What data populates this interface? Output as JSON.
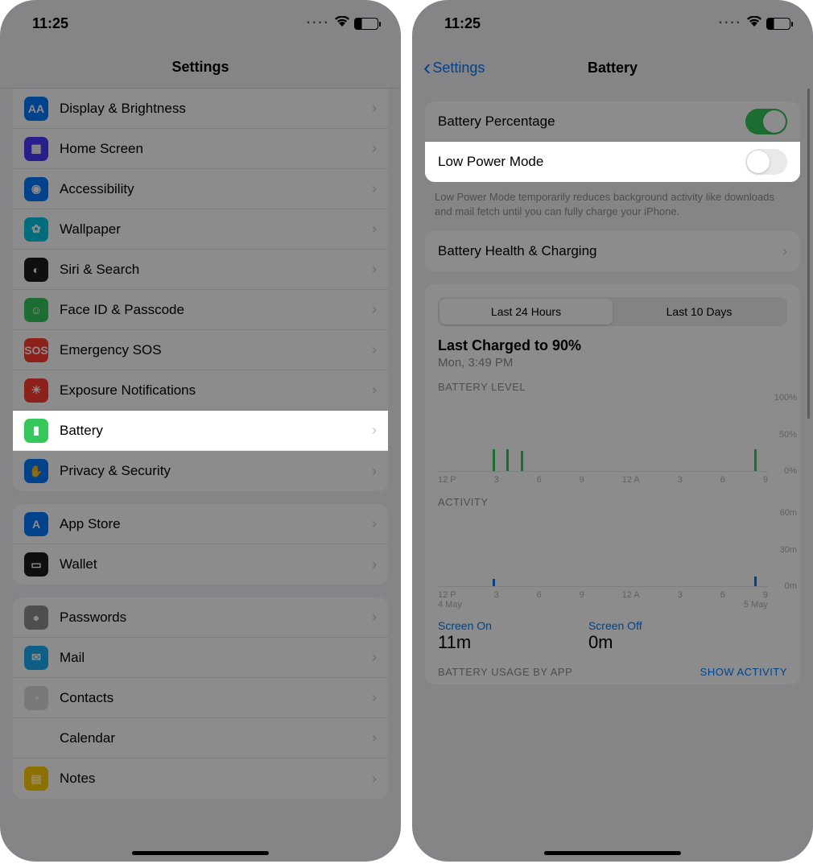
{
  "status": {
    "time": "11:25",
    "battery_pct": "31"
  },
  "left": {
    "title": "Settings",
    "groups": [
      [
        {
          "icon": "AA",
          "bg": "#007aff",
          "label": "Display & Brightness",
          "name": "display-brightness"
        },
        {
          "icon": "▦",
          "bg": "#4a3aff",
          "label": "Home Screen",
          "name": "home-screen"
        },
        {
          "icon": "◉",
          "bg": "#007aff",
          "label": "Accessibility",
          "name": "accessibility"
        },
        {
          "icon": "✿",
          "bg": "#00c7e6",
          "label": "Wallpaper",
          "name": "wallpaper"
        },
        {
          "icon": "◐",
          "bg": "#1c1c1e",
          "label": "Siri & Search",
          "name": "siri-search"
        },
        {
          "icon": "☺",
          "bg": "#34c759",
          "label": "Face ID & Passcode",
          "name": "face-id"
        },
        {
          "icon": "SOS",
          "bg": "#ff3b30",
          "label": "Emergency SOS",
          "name": "emergency-sos"
        },
        {
          "icon": "☀",
          "bg": "#ff3b30",
          "label": "Exposure Notifications",
          "name": "exposure"
        },
        {
          "icon": "▮",
          "bg": "#34c759",
          "label": "Battery",
          "name": "battery",
          "highlight": true
        },
        {
          "icon": "✋",
          "bg": "#007aff",
          "label": "Privacy & Security",
          "name": "privacy"
        }
      ],
      [
        {
          "icon": "A",
          "bg": "#007aff",
          "label": "App Store",
          "name": "app-store"
        },
        {
          "icon": "▭",
          "bg": "#1c1c1e",
          "label": "Wallet",
          "name": "wallet"
        }
      ],
      [
        {
          "icon": "●",
          "bg": "#8e8e93",
          "label": "Passwords",
          "name": "passwords"
        },
        {
          "icon": "✉",
          "bg": "#1badf8",
          "label": "Mail",
          "name": "mail"
        },
        {
          "icon": "◔",
          "bg": "#dcdcdc",
          "label": "Contacts",
          "name": "contacts"
        },
        {
          "icon": "▦",
          "bg": "#ffffff",
          "label": "Calendar",
          "name": "calendar"
        },
        {
          "icon": "▤",
          "bg": "#ffcc00",
          "label": "Notes",
          "name": "notes"
        }
      ]
    ]
  },
  "right": {
    "back": "Settings",
    "title": "Battery",
    "percentage_label": "Battery Percentage",
    "percentage_on": true,
    "low_power_label": "Low Power Mode",
    "low_power_on": false,
    "low_power_desc": "Low Power Mode temporarily reduces background activity like downloads and mail fetch until you can fully charge your iPhone.",
    "health_label": "Battery Health & Charging",
    "segments": [
      "Last 24 Hours",
      "Last 10 Days"
    ],
    "segment_selected": 0,
    "charged_title": "Last Charged to 90%",
    "charged_sub": "Mon, 3:49 PM",
    "screen_on_label": "Screen On",
    "screen_on_value": "11m",
    "screen_off_label": "Screen Off",
    "screen_off_value": "0m",
    "usage_header": "BATTERY USAGE BY APP",
    "show_activity": "SHOW ACTIVITY"
  },
  "chart_data": [
    {
      "type": "bar",
      "title": "BATTERY LEVEL",
      "categories": [
        "12 P",
        "3",
        "6",
        "9",
        "12 A",
        "3",
        "6",
        "9"
      ],
      "values": [
        0,
        0,
        0,
        0,
        30,
        30,
        28,
        0,
        0,
        0,
        0,
        0,
        0,
        0,
        0,
        0,
        0,
        0,
        0,
        0,
        0,
        0,
        0,
        30
      ],
      "ylim": [
        0,
        100
      ],
      "ylab": [
        "100%",
        "50%",
        "0%"
      ],
      "color": "#34c759"
    },
    {
      "type": "bar",
      "title": "ACTIVITY",
      "categories": [
        "12 P",
        "3",
        "6",
        "9",
        "12 A",
        "3",
        "6",
        "9"
      ],
      "sublabels": [
        "4 May",
        "5 May"
      ],
      "values": [
        0,
        0,
        0,
        0,
        6,
        0,
        0,
        0,
        0,
        0,
        0,
        0,
        0,
        0,
        0,
        0,
        0,
        0,
        0,
        0,
        0,
        0,
        0,
        8
      ],
      "ylim": [
        0,
        60
      ],
      "ylab": [
        "60m",
        "30m",
        "0m"
      ],
      "color": "#007aff"
    }
  ]
}
